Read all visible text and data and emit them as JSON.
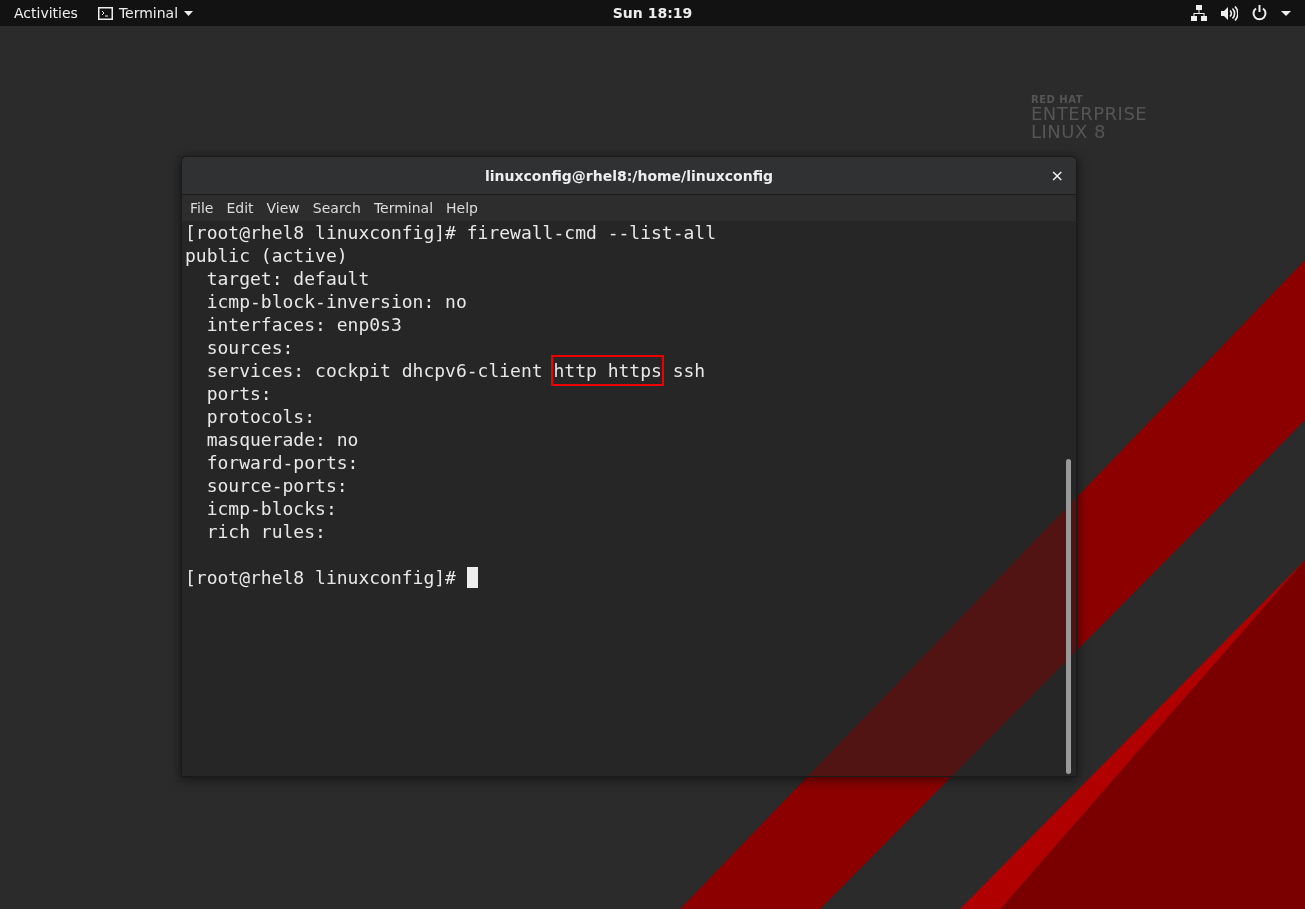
{
  "top_bar": {
    "activities": "Activities",
    "app_menu": "Terminal",
    "clock": "Sun 18:19"
  },
  "wallpaper": {
    "logo_lines": [
      "RED HAT",
      "ENTERPRISE",
      "LINUX 8"
    ]
  },
  "window": {
    "title": "linuxconfig@rhel8:/home/linuxconfig",
    "close": "×",
    "menu": [
      "File",
      "Edit",
      "View",
      "Search",
      "Terminal",
      "Help"
    ],
    "lines": [
      {
        "kind": "output",
        "segments": [
          {
            "text": "[root@rhel8 linuxconfig]# firewall-cmd --list-all",
            "highlighted": false
          }
        ]
      },
      {
        "kind": "output",
        "segments": [
          {
            "text": "public (active)",
            "highlighted": false
          }
        ]
      },
      {
        "kind": "output",
        "segments": [
          {
            "text": "  target: default",
            "highlighted": false
          }
        ]
      },
      {
        "kind": "output",
        "segments": [
          {
            "text": "  icmp-block-inversion: no",
            "highlighted": false
          }
        ]
      },
      {
        "kind": "output",
        "segments": [
          {
            "text": "  interfaces: enp0s3",
            "highlighted": false
          }
        ]
      },
      {
        "kind": "output",
        "segments": [
          {
            "text": "  sources:",
            "highlighted": false
          }
        ]
      },
      {
        "kind": "output",
        "segments": [
          {
            "text": "  services: cockpit dhcpv6-client ",
            "highlighted": false
          },
          {
            "text": "http https",
            "highlighted": true
          },
          {
            "text": " ssh",
            "highlighted": false
          }
        ]
      },
      {
        "kind": "output",
        "segments": [
          {
            "text": "  ports:",
            "highlighted": false
          }
        ]
      },
      {
        "kind": "output",
        "segments": [
          {
            "text": "  protocols:",
            "highlighted": false
          }
        ]
      },
      {
        "kind": "output",
        "segments": [
          {
            "text": "  masquerade: no",
            "highlighted": false
          }
        ]
      },
      {
        "kind": "output",
        "segments": [
          {
            "text": "  forward-ports:",
            "highlighted": false
          }
        ]
      },
      {
        "kind": "output",
        "segments": [
          {
            "text": "  source-ports:",
            "highlighted": false
          }
        ]
      },
      {
        "kind": "output",
        "segments": [
          {
            "text": "  icmp-blocks:",
            "highlighted": false
          }
        ]
      },
      {
        "kind": "output",
        "segments": [
          {
            "text": "  rich rules:",
            "highlighted": false
          }
        ]
      },
      {
        "kind": "prompt",
        "segments": [
          {
            "text": "[root@rhel8 linuxconfig]# ",
            "highlighted": false
          }
        ]
      }
    ]
  }
}
